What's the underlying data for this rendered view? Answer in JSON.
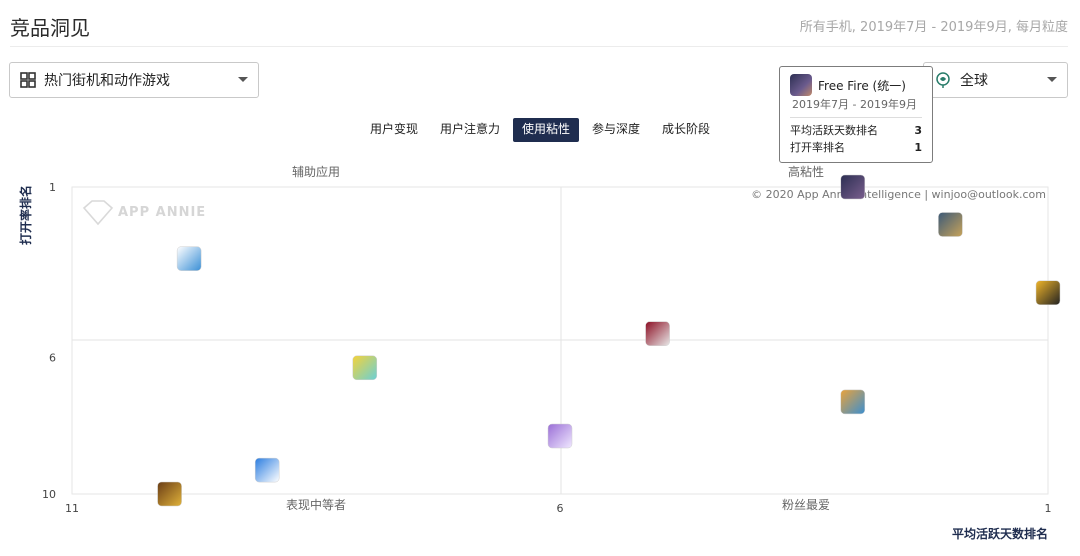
{
  "header": {
    "title": "竞品洞见",
    "meta": "所有手机, 2019年7月 - 2019年9月, 每月粒度"
  },
  "filters": {
    "category": "热门街机和动作游戏",
    "region": "全球"
  },
  "tabs": [
    {
      "label": "用户变现",
      "active": false
    },
    {
      "label": "用户注意力",
      "active": false
    },
    {
      "label": "使用粘性",
      "active": true
    },
    {
      "label": "参与深度",
      "active": false
    },
    {
      "label": "成长阶段",
      "active": false
    }
  ],
  "tooltip": {
    "app_name": "Free Fire (统一)",
    "date_range": "2019年7月 - 2019年9月",
    "rows": [
      {
        "label": "平均活跃天数排名",
        "value": "3"
      },
      {
        "label": "打开率排名",
        "value": "1"
      }
    ]
  },
  "chart_data": {
    "type": "scatter",
    "title": "",
    "xlabel": "平均活跃天数排名",
    "ylabel": "打开率排名",
    "xlim": [
      11,
      1
    ],
    "ylim": [
      1,
      10
    ],
    "x_ticks": [
      "11",
      "6",
      "1"
    ],
    "y_ticks": [
      "1",
      "6",
      "10"
    ],
    "quadrant_labels": {
      "top_left": "辅助应用",
      "top_right": "高粘性",
      "bottom_left": "表现中等者",
      "bottom_right": "粉丝最爱"
    },
    "credit": "© 2020 App Annie Intelligence | winjoo@outlook.com",
    "watermark": "APP ANNIE",
    "points": [
      {
        "x": 3.0,
        "y": 1.0,
        "icon": "free-fire-icon",
        "colors": [
          "#2c2f52",
          "#7a5f8e"
        ]
      },
      {
        "x": 2.0,
        "y": 2.1,
        "icon": "pubg-icon",
        "colors": [
          "#3c5a78",
          "#c7a35a"
        ]
      },
      {
        "x": 1.0,
        "y": 4.1,
        "icon": "brawl-stars-icon",
        "colors": [
          "#f0b52a",
          "#222222"
        ]
      },
      {
        "x": 9.8,
        "y": 3.1,
        "icon": "bird-app-icon",
        "colors": [
          "#ffffff",
          "#3a8fd6"
        ]
      },
      {
        "x": 5.0,
        "y": 5.3,
        "icon": "red-game-icon",
        "colors": [
          "#8c0f24",
          "#e8e8e8"
        ]
      },
      {
        "x": 8.0,
        "y": 6.3,
        "icon": "yellow-cube-icon",
        "colors": [
          "#f4d23a",
          "#6ad0d6"
        ]
      },
      {
        "x": 3.0,
        "y": 7.3,
        "icon": "subway-surfers-icon",
        "colors": [
          "#e9a23b",
          "#3b8fd0"
        ]
      },
      {
        "x": 6.0,
        "y": 8.3,
        "icon": "purple-stairs-icon",
        "colors": [
          "#9a6ed6",
          "#f0e8ff"
        ]
      },
      {
        "x": 9.0,
        "y": 9.3,
        "icon": "balloon-icon",
        "colors": [
          "#2b7de0",
          "#ffffff"
        ]
      },
      {
        "x": 10.0,
        "y": 10.0,
        "icon": "warrior-game-icon",
        "colors": [
          "#6a3d16",
          "#e0b23a"
        ]
      }
    ]
  }
}
